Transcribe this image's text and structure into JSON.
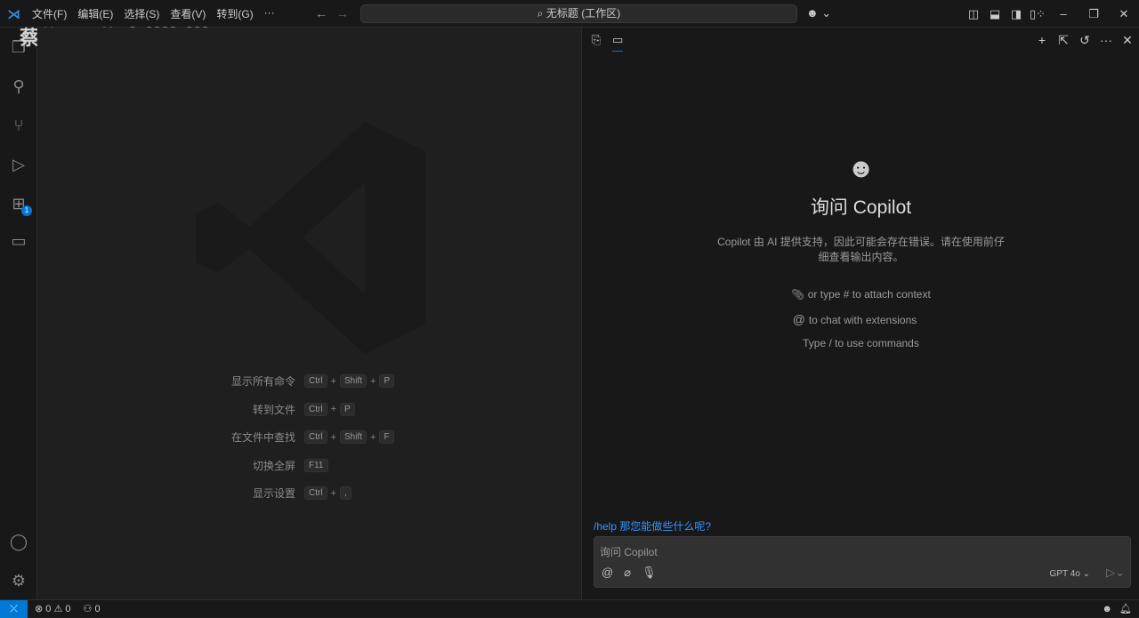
{
  "titlebar": {
    "menu": [
      "文件(F)",
      "编辑(E)",
      "选择(S)",
      "查看(V)",
      "转到(G)",
      "···"
    ],
    "search": "无标题 (工作区)"
  },
  "watermark": {
    "text": "蔡蔡小趴菜",
    "logo": "bilibili"
  },
  "activity": {
    "extensions_badge": "1"
  },
  "shortcuts": [
    {
      "label": "显示所有命令",
      "keys": [
        "Ctrl",
        "Shift",
        "P"
      ]
    },
    {
      "label": "转到文件",
      "keys": [
        "Ctrl",
        "P"
      ]
    },
    {
      "label": "在文件中查找",
      "keys": [
        "Ctrl",
        "Shift",
        "F"
      ]
    },
    {
      "label": "切换全屏",
      "keys": [
        "F11"
      ]
    },
    {
      "label": "显示设置",
      "keys": [
        "Ctrl",
        ","
      ]
    }
  ],
  "chat": {
    "title": "询问 Copilot",
    "description": "Copilot 由 AI 提供支持，因此可能会存在错误。请在使用前仔细查看输出内容。",
    "hints": [
      "or type # to attach context",
      "to chat with extensions",
      "Type / to use commands"
    ],
    "help": "/help 那您能做些什么呢?",
    "input_placeholder": "询问 Copilot",
    "model": "GPT 4o"
  },
  "status": {
    "errors": "0",
    "warnings": "0",
    "ports": "0"
  },
  "colors": {
    "accent": "#0078d4",
    "link": "#3794ff"
  }
}
